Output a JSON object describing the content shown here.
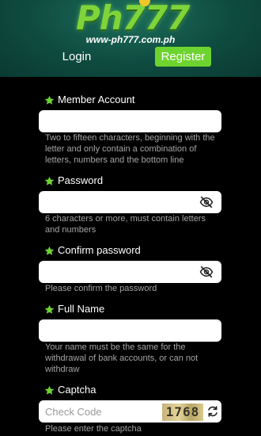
{
  "header": {
    "logo_text": "Ph777",
    "site_url": "www-ph777.com.ph",
    "tabs": {
      "login": "Login",
      "register": "Register"
    }
  },
  "form": {
    "member_account": {
      "label": "Member Account",
      "value": "",
      "hint": "Two to fifteen characters, beginning with the letter and only contain a combination of letters, numbers and the bottom line"
    },
    "password": {
      "label": "Password",
      "value": "",
      "hint": "6 characters or more, must contain letters and numbers"
    },
    "confirm_password": {
      "label": "Confirm password",
      "value": "",
      "hint": "Please confirm the password"
    },
    "full_name": {
      "label": "Full Name",
      "value": "",
      "hint": "Your name must be the same for the withdrawal of bank accounts, or can not withdraw"
    },
    "captcha": {
      "label": "Captcha",
      "placeholder": "Check Code",
      "code": "1768",
      "hint": "Please enter the captcha"
    }
  },
  "colors": {
    "accent": "#6dd42f",
    "header_bg": "#0f4b40",
    "background": "#000000",
    "hint_text": "#a5a5a5"
  },
  "icons": [
    "star-icon",
    "eye-off-icon",
    "refresh-icon"
  ]
}
